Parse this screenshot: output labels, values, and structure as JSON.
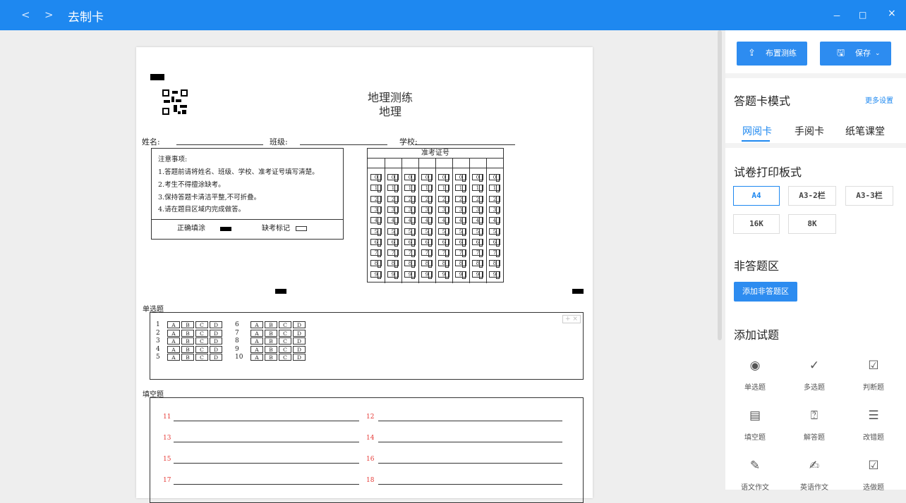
{
  "titlebar": {
    "back": "<",
    "forward": ">",
    "title": "去制卡",
    "minimize": "－",
    "maximize": "□",
    "close": "×"
  },
  "sheet": {
    "title": "地理测练",
    "subtitle": "地理",
    "fields": {
      "name": "姓名:",
      "class": "班级:",
      "school": "学校:"
    },
    "notice": {
      "heading": "注意事项:",
      "items": [
        "1.答题前请将姓名、班级、学校、准考证号填写清楚。",
        "2.考生不得擅涂缺考。",
        "3.保持答题卡清洁平整,不可折叠。",
        "4.请在题目区域内完成做答。"
      ],
      "correct_fill": "正确填涂",
      "absent_mark": "缺考标记"
    },
    "ticket": {
      "heading": "准考证号",
      "digits": [
        "0",
        "1",
        "2",
        "3",
        "4",
        "5",
        "6",
        "7",
        "8",
        "9"
      ]
    },
    "mc_section": "单选题",
    "mc_questions": [
      "1",
      "2",
      "3",
      "4",
      "5",
      "6",
      "7",
      "8",
      "9",
      "10"
    ],
    "mc_options": [
      "A",
      "B",
      "C",
      "D"
    ],
    "mc_controls": "+ ×",
    "fill_section": "填空题",
    "fill_numbers": [
      "11",
      "12",
      "13",
      "14",
      "15",
      "16",
      "17",
      "18"
    ]
  },
  "panel": {
    "publish_label": "布置测练",
    "save_label": "保存",
    "mode_title": "答题卡模式",
    "more_settings": "更多设置",
    "tabs": [
      "网阅卡",
      "手阅卡",
      "纸笔课堂"
    ],
    "print_title": "试卷打印板式",
    "print_options": [
      "A4",
      "A3-2栏",
      "A3-3栏",
      "16K",
      "8K"
    ],
    "non_answer_title": "非答题区",
    "add_non_answer": "添加非答题区",
    "add_question_title": "添加试题",
    "question_types": [
      {
        "label": "单选题",
        "icon": "radio-icon"
      },
      {
        "label": "多选题",
        "icon": "check-circle-icon"
      },
      {
        "label": "判断题",
        "icon": "judge-icon"
      },
      {
        "label": "填空题",
        "icon": "fill-blank-icon"
      },
      {
        "label": "解答题",
        "icon": "answer-icon"
      },
      {
        "label": "改错题",
        "icon": "correction-icon"
      },
      {
        "label": "语文作文",
        "icon": "chinese-essay-icon"
      },
      {
        "label": "英语作文",
        "icon": "english-essay-icon"
      },
      {
        "label": "选做题",
        "icon": "optional-icon"
      }
    ],
    "accent": "#1e88f0"
  }
}
